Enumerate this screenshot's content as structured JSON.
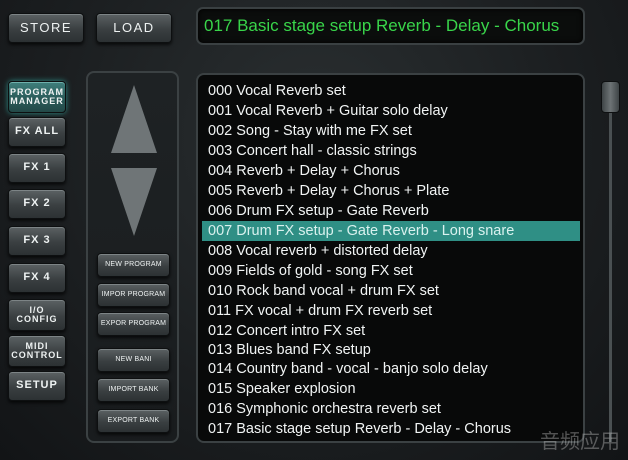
{
  "top": {
    "store_label": "STORE",
    "load_label": "LOAD"
  },
  "display": {
    "current_preset": "017 Basic stage setup Reverb - Delay - Chorus"
  },
  "sidebar": {
    "program_manager": [
      "PROGRAM",
      "MANAGER"
    ],
    "fx_all": "FX ALL",
    "fx1": "FX 1",
    "fx2": "FX 2",
    "fx3": "FX 3",
    "fx4": "FX 4",
    "io_config": [
      "I/O",
      "CONFIG"
    ],
    "midi_control": [
      "MIDI",
      "CONTROL"
    ],
    "setup": "SETUP"
  },
  "actions": {
    "new_program": "NEW PROGRAM",
    "import_program": "IMPOR PROGRAM",
    "export_program": "EXPOR PROGRAM",
    "new_bank": "NEW BANI",
    "import_bank": "IMPORT BANK",
    "export_bank": "EXPORT BANK"
  },
  "presets": [
    "000 Vocal Reverb set",
    "001 Vocal Reverb + Guitar solo delay",
    "002 Song - Stay with me FX set",
    "003 Concert hall - classic strings",
    "004 Reverb + Delay + Chorus",
    "005 Reverb + Delay + Chorus + Plate",
    "006 Drum FX setup - Gate Reverb",
    "007 Drum FX setup - Gate Reverb - Long snare",
    "008 Vocal reverb + distorted delay",
    "009 Fields of gold - song FX set",
    "010 Rock band vocal + drum FX set",
    "011 FX vocal + drum FX reverb set",
    "012 Concert intro FX set",
    "013 Blues band FX setup",
    "014 Country band - vocal - banjo solo delay",
    "015 Speaker explosion",
    "016 Symphonic orchestra reverb set",
    "017 Basic stage setup Reverb - Delay - Chorus"
  ],
  "selected_index": 7,
  "watermark": "音频应用",
  "colors": {
    "display_text": "#39d54a",
    "selection": "#2f8f85",
    "active_button": "#2b5c5a"
  }
}
